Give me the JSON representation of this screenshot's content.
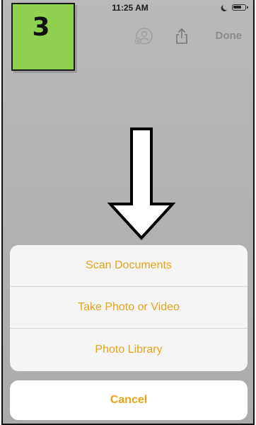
{
  "status_bar": {
    "time": "11:25 AM"
  },
  "nav": {
    "done_label": "Done"
  },
  "step_badge": {
    "number": "3",
    "color": "#8fd14f"
  },
  "action_sheet": {
    "options": [
      {
        "label": "Scan Documents"
      },
      {
        "label": "Take Photo or Video"
      },
      {
        "label": "Photo Library"
      }
    ],
    "cancel_label": "Cancel",
    "accent_color": "#e6a519"
  },
  "icons": [
    "moon-icon",
    "battery-icon",
    "add-people-icon",
    "share-icon",
    "down-arrow-icon"
  ]
}
